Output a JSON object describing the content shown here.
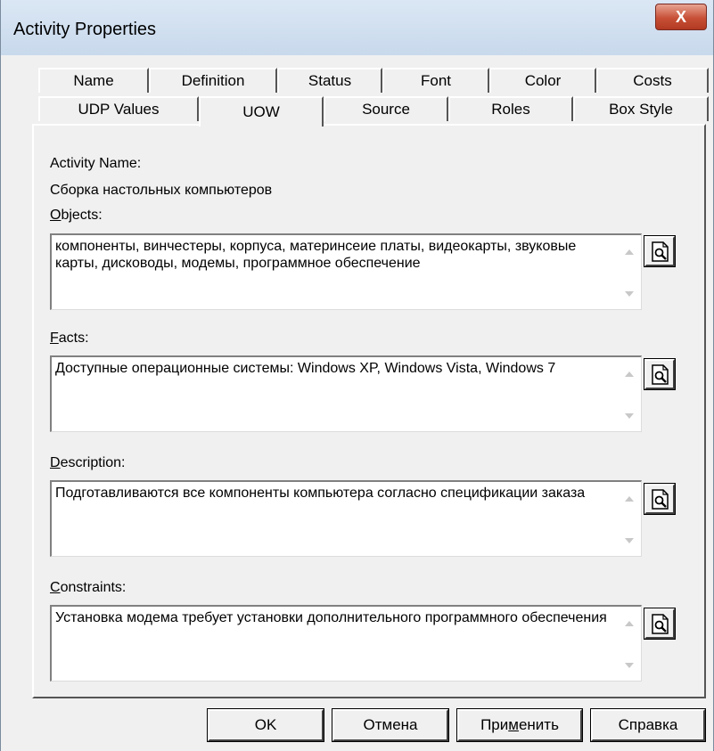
{
  "window": {
    "title": "Activity Properties",
    "close_label": "X"
  },
  "tabs": {
    "row_back": [
      "Name",
      "Definition",
      "Status",
      "Font",
      "Color",
      "Costs"
    ],
    "row_front": [
      "UDP Values",
      "UOW",
      "Source",
      "Roles",
      "Box Style"
    ],
    "active": "UOW"
  },
  "uow": {
    "activity_name_label": "Activity Name:",
    "activity_name_value": "Сборка настольных компьютеров",
    "objects_label_mnemonic": "O",
    "objects_label_rest": "bjects:",
    "objects_value": "компоненты, винчестеры, корпуса, материнсеие платы, видеокарты, звуковые карты, дисководы, модемы, программное обеспечение",
    "facts_label_mnemonic": "F",
    "facts_label_rest": "acts:",
    "facts_value": "Доступные операционные системы: Windows XP, Windows Vista, Windows 7",
    "description_label_mnemonic": "D",
    "description_label_rest": "escription:",
    "description_value": "Подготавливаются все компоненты компьютера согласно спецификации заказа",
    "constraints_label_mnemonic": "C",
    "constraints_label_rest": "onstraints:",
    "constraints_value": "Установка модема требует установки дополнительного программного обеспечения"
  },
  "buttons": {
    "ok": "OK",
    "cancel": "Отмена",
    "apply_pre": "При",
    "apply_mnemonic": "м",
    "apply_post": "енить",
    "help": "Справка"
  }
}
